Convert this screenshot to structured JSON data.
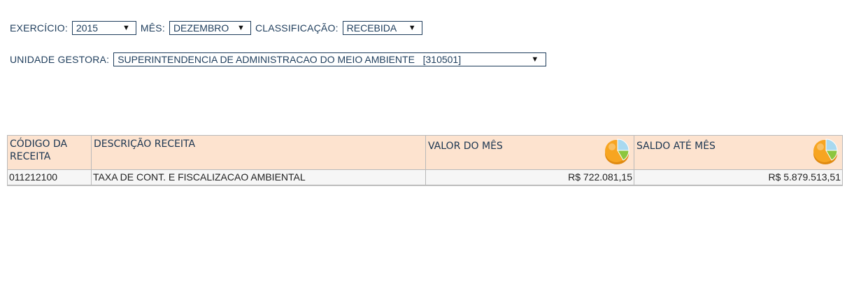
{
  "filters": {
    "exercicio_label": "EXERCÍCIO:",
    "exercicio_value": "2015",
    "mes_label": "MÊS:",
    "mes_value": "DEZEMBRO",
    "classificacao_label": "CLASSIFICAÇÃO:",
    "classificacao_value": "RECEBIDA",
    "unidade_label": "UNIDADE GESTORA:",
    "unidade_value": "SUPERINTENDENCIA DE ADMINISTRACAO DO MEIO AMBIENTE   [310501]"
  },
  "table": {
    "headers": [
      "CÓDIGO DA RECEITA",
      "DESCRIÇÃO RECEITA",
      "VALOR DO MÊS",
      "SALDO ATÉ MÊS"
    ],
    "rows": [
      {
        "codigo": "011212100",
        "descricao": "TAXA DE CONT. E FISCALIZACAO AMBIENTAL",
        "valor_mes": "R$ 722.081,15",
        "saldo": "R$ 5.879.513,51"
      }
    ]
  },
  "icons": {
    "chart": "pie-chart-icon"
  },
  "colors": {
    "header_bg": "#fde3cf",
    "text": "#1e3d5c"
  }
}
